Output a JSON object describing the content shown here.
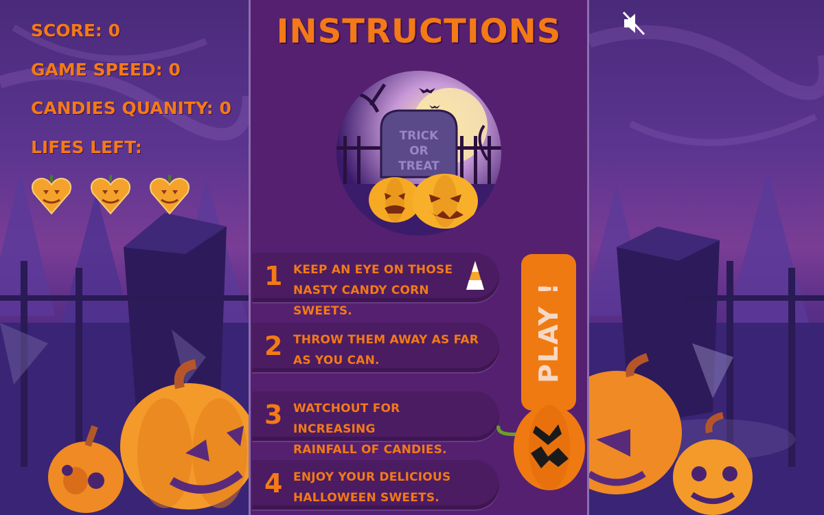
{
  "hud": {
    "score_label": "SCORE: 0",
    "speed_label": "GAME SPEED: 0",
    "candies_label": "CANDIES QUANITY: 0",
    "lifes_label": "LIFES LEFT:",
    "lifes_count": 3
  },
  "instructions": {
    "title": "INSTRUCTIONS",
    "badge_text_line1": "TRICK",
    "badge_text_line2": "OR",
    "badge_text_line3": "TREAT",
    "steps": [
      {
        "number": "1",
        "text_line1": "KEEP AN EYE ON THOSE",
        "text_line2": "NASTY CANDY CORN SWEETS."
      },
      {
        "number": "2",
        "text_line1": "THROW THEM AWAY AS FAR",
        "text_line2": "AS YOU CAN."
      },
      {
        "number": "3",
        "text_line1": "WATCHOUT FOR INCREASING",
        "text_line2": "RAINFALL OF CANDIES."
      },
      {
        "number": "4",
        "text_line1": "ENJOY YOUR DELICIOUS",
        "text_line2": "HALLOWEEN SWEETS."
      }
    ]
  },
  "play_button": {
    "label": "PLAY !"
  },
  "sound": {
    "state": "muted",
    "icon": "speaker-muted-icon"
  },
  "colors": {
    "accent": "#f37a16",
    "panel": "#55206f",
    "play_text": "#f7d8c6"
  }
}
